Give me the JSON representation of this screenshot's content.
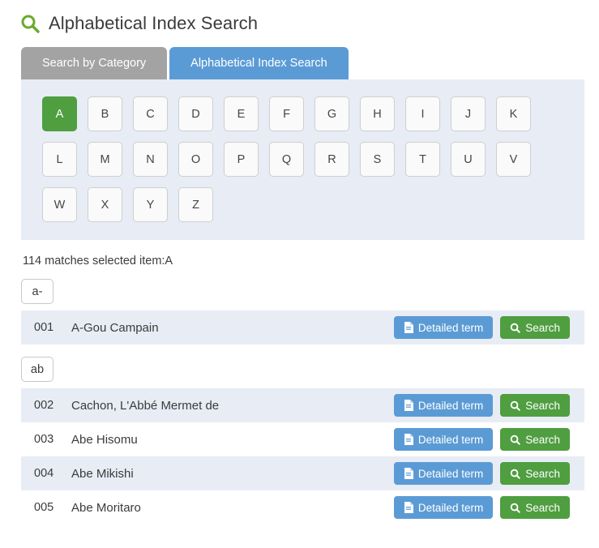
{
  "header": {
    "icon": "search-icon",
    "title": "Alphabetical Index Search"
  },
  "tabs": [
    {
      "label": "Search by Category",
      "active": false
    },
    {
      "label": "Alphabetical Index Search",
      "active": true
    }
  ],
  "alpha_panel": {
    "rows": [
      [
        "A",
        "B",
        "C",
        "D",
        "E",
        "F",
        "G",
        "H",
        "I",
        "J",
        "K"
      ],
      [
        "L",
        "M",
        "N",
        "O",
        "P",
        "Q",
        "R",
        "S",
        "T",
        "U",
        "V"
      ],
      [
        "W",
        "X",
        "Y",
        "Z"
      ]
    ],
    "selected": "A"
  },
  "summary": {
    "text": "114 matches  selected item:A",
    "match_count": "114",
    "selected_item": "A"
  },
  "buttons": {
    "detail_label": "Detailed term",
    "detail_icon": "document-icon",
    "search_label": "Search",
    "search_icon": "magnifier-icon"
  },
  "groups": [
    {
      "chip": "a-",
      "rows": [
        {
          "num": "001",
          "name": "A-Gou Campain"
        }
      ]
    },
    {
      "chip": "ab",
      "rows": [
        {
          "num": "002",
          "name": "Cachon, L'Abbé Mermet de"
        },
        {
          "num": "003",
          "name": "Abe Hisomu"
        },
        {
          "num": "004",
          "name": "Abe Mikishi"
        },
        {
          "num": "005",
          "name": "Abe Moritaro"
        }
      ]
    }
  ],
  "colors": {
    "accent_blue": "#5b9bd5",
    "accent_green": "#4f9e40",
    "tab_inactive": "#a3a3a3",
    "panel_bg": "#e7ecf5",
    "row_alt_bg": "#e7ecf5"
  }
}
